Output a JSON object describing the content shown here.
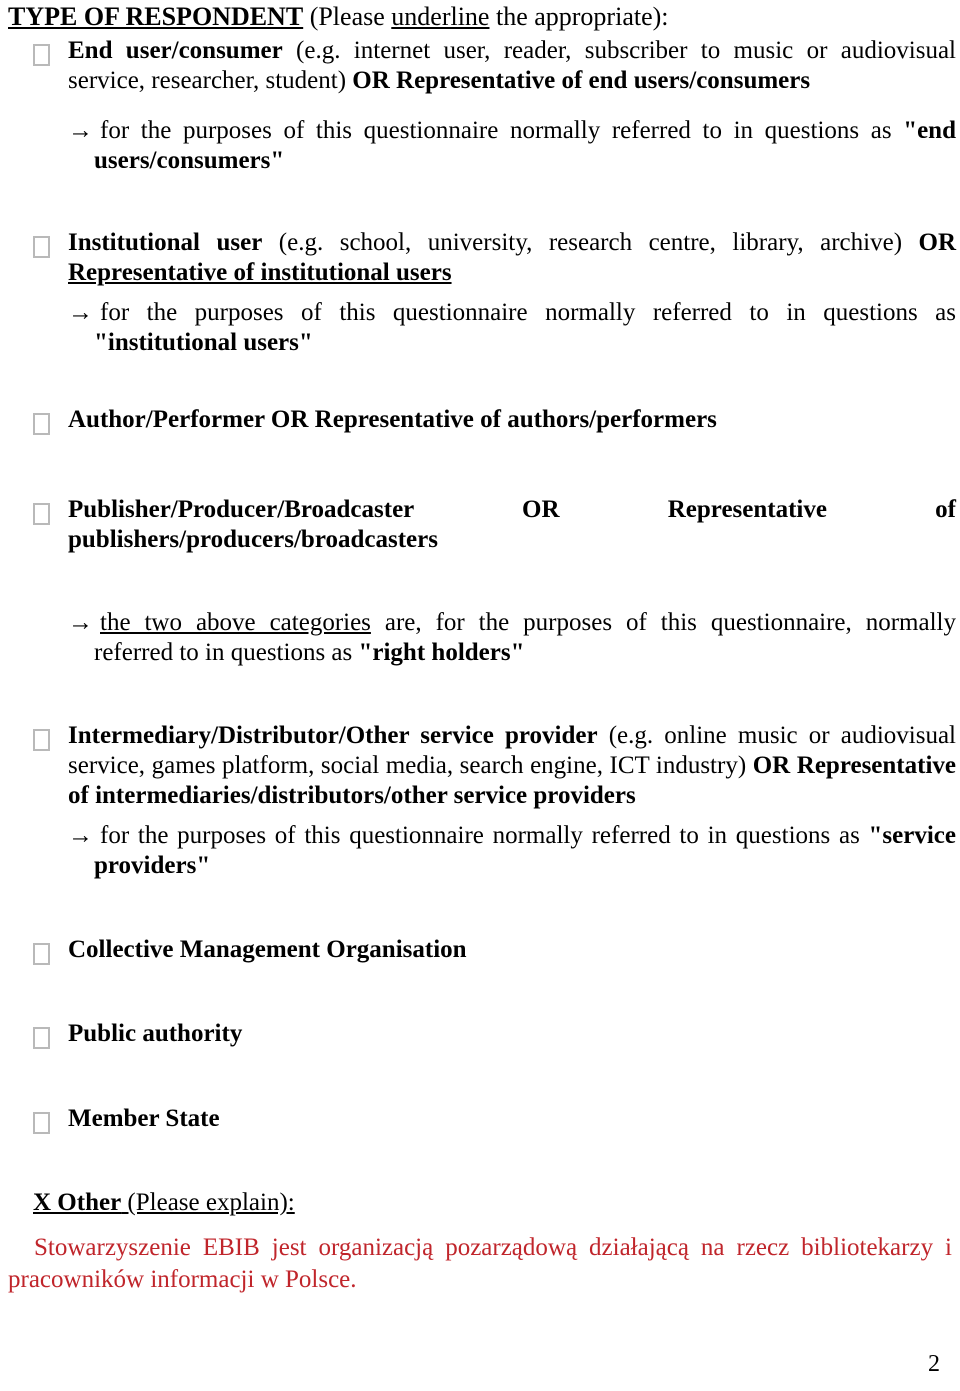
{
  "document": {
    "heading": {
      "title": "TYPE OF RESPONDENT",
      "instruction_before": " (Please ",
      "instruction_underlined": "underline",
      "instruction_after": " the appropriate):"
    },
    "options": [
      {
        "id": "end-user-consumer",
        "checkbox_state": "unchecked",
        "label_bold": "End user/consumer",
        "label_rest": " (e.g. internet user, reader, subscriber to music or audiovisual service, researcher, student) ",
        "label_bold_tail": "OR Representative of end users/consumers",
        "note_arrow": "→",
        "note_text": "for the purposes of this questionnaire normally referred to in questions as ",
        "note_term": "\"end users/consumers\""
      },
      {
        "id": "institutional-user",
        "checkbox_state": "unchecked",
        "label_bold": "Institutional user",
        "label_rest": " (e.g. school, university, research centre, library, archive) ",
        "label_bold_tail": "OR",
        "label_bold_underlined_tail": "Representative of institutional users",
        "note_arrow": "→",
        "note_text": "for the purposes of this questionnaire normally referred to in questions as ",
        "note_term": "\"institutional users\""
      },
      {
        "id": "author-performer",
        "checkbox_state": "unchecked",
        "label_bold": "Author/Performer OR Representative of authors/performers"
      },
      {
        "id": "publisher-producer-broadcaster",
        "checkbox_state": "unchecked",
        "label_bold": "Publisher/Producer/Broadcaster OR Representative of publishers/producers/broadcasters"
      },
      {
        "id": "intermediary-distributor",
        "checkbox_state": "unchecked",
        "label_bold": "Intermediary/Distributor/Other service provider",
        "label_rest": " (e.g. online music or audiovisual service, games platform, social media, search engine, ICT industry) ",
        "label_bold_tail": "OR Representative of intermediaries/distributors/other service providers",
        "note_arrow": "→",
        "note_text": "for the purposes of this questionnaire normally referred to in questions as ",
        "note_term": "\"service providers\""
      },
      {
        "id": "collective-management-organisation",
        "checkbox_state": "unchecked",
        "label_bold": "Collective Management Organisation"
      },
      {
        "id": "public-authority",
        "checkbox_state": "unchecked",
        "label_bold": "Public authority"
      },
      {
        "id": "member-state",
        "checkbox_state": "unchecked",
        "label_bold": "Member State"
      }
    ],
    "right_holders_note": {
      "arrow": "→",
      "underlined": "the two above categories",
      "text": " are, for the purposes of this questionnaire, normally referred to in questions as ",
      "term": "\"right holders\""
    },
    "other_field": {
      "marker_label": "X Other",
      "hint": " (Please explain):",
      "answer": "Stowarzyszenie EBIB jest organizacją pozarządową działającą na rzecz bibliotekarzy i pracowników informacji w Polsce.",
      "answer_color": "#c0252b"
    },
    "page_number": "2"
  }
}
